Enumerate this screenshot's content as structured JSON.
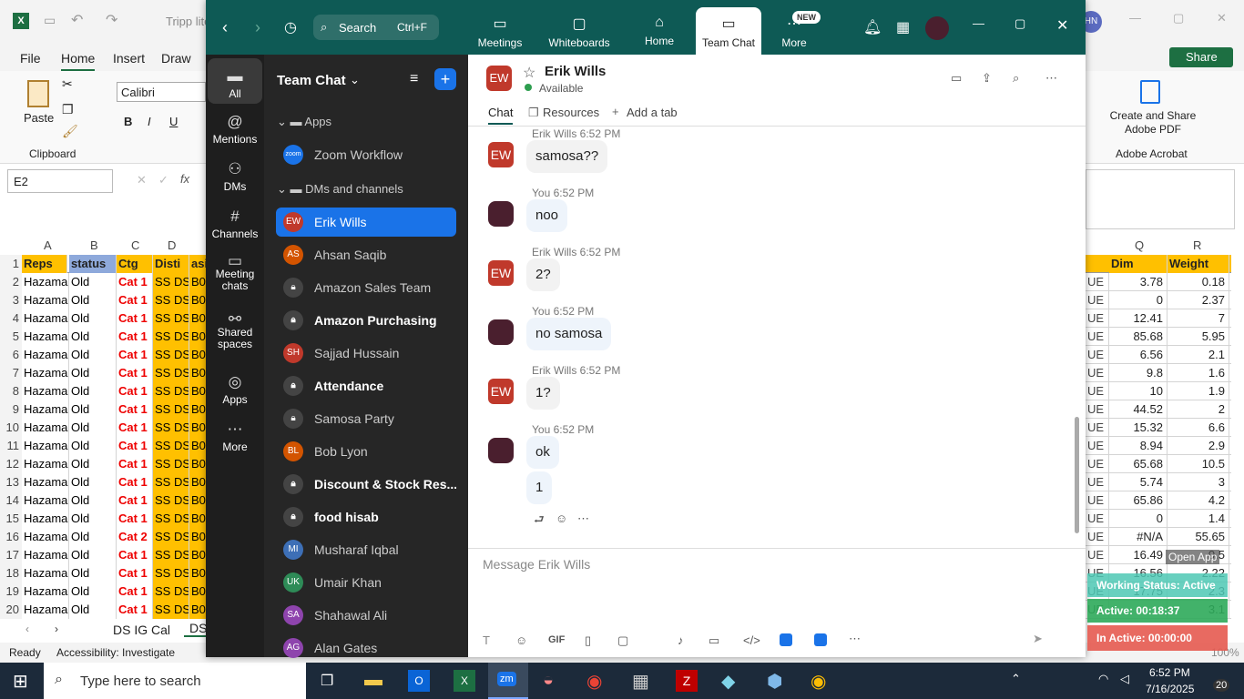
{
  "excel": {
    "title": "Tripp lite",
    "menu": [
      "File",
      "Home",
      "Insert",
      "Draw"
    ],
    "font": "Calibri",
    "namebox": "E2",
    "clipboard": "Clipboard",
    "paste": "Paste",
    "create_share": "Create and Share Adobe PDF",
    "adobe": "Adobe Acrobat",
    "share": "Share",
    "avatar": "HN",
    "col_headers": [
      "A",
      "B",
      "C",
      "D"
    ],
    "right_cols": [
      "Q",
      "R"
    ],
    "header_row": [
      "Reps",
      "status",
      "Ctg",
      "Disti",
      "asi"
    ],
    "right_header": [
      "Dim",
      "Weight"
    ],
    "rows": [
      {
        "n": "2",
        "a": "Hazama",
        "b": "Old",
        "c": "Cat 1",
        "d": "SS DS",
        "e": "B0",
        "q": "3.78",
        "r": "0.18"
      },
      {
        "n": "3",
        "a": "Hazama",
        "b": "Old",
        "c": "Cat 1",
        "d": "SS DS",
        "e": "B0",
        "q": "0",
        "r": "2.37"
      },
      {
        "n": "4",
        "a": "Hazama",
        "b": "Old",
        "c": "Cat 1",
        "d": "SS DS",
        "e": "B0",
        "q": "12.41",
        "r": "7"
      },
      {
        "n": "5",
        "a": "Hazama",
        "b": "Old",
        "c": "Cat 1",
        "d": "SS DS",
        "e": "B0",
        "q": "85.68",
        "r": "5.95"
      },
      {
        "n": "6",
        "a": "Hazama",
        "b": "Old",
        "c": "Cat 1",
        "d": "SS DS",
        "e": "B0",
        "q": "6.56",
        "r": "2.1"
      },
      {
        "n": "7",
        "a": "Hazama",
        "b": "Old",
        "c": "Cat 1",
        "d": "SS DS",
        "e": "B0",
        "q": "9.8",
        "r": "1.6"
      },
      {
        "n": "8",
        "a": "Hazama",
        "b": "Old",
        "c": "Cat 1",
        "d": "SS DS",
        "e": "B0",
        "q": "10",
        "r": "1.9"
      },
      {
        "n": "9",
        "a": "Hazama",
        "b": "Old",
        "c": "Cat 1",
        "d": "SS DS",
        "e": "B0",
        "q": "44.52",
        "r": "2"
      },
      {
        "n": "10",
        "a": "Hazama",
        "b": "Old",
        "c": "Cat 1",
        "d": "SS DS",
        "e": "B0",
        "q": "15.32",
        "r": "6.6"
      },
      {
        "n": "11",
        "a": "Hazama",
        "b": "Old",
        "c": "Cat 1",
        "d": "SS DS",
        "e": "B0",
        "q": "8.94",
        "r": "2.9"
      },
      {
        "n": "12",
        "a": "Hazama",
        "b": "Old",
        "c": "Cat 1",
        "d": "SS DS",
        "e": "B0",
        "q": "65.68",
        "r": "10.5"
      },
      {
        "n": "13",
        "a": "Hazama",
        "b": "Old",
        "c": "Cat 1",
        "d": "SS DS",
        "e": "B0",
        "q": "5.74",
        "r": "3"
      },
      {
        "n": "14",
        "a": "Hazama",
        "b": "Old",
        "c": "Cat 1",
        "d": "SS DS",
        "e": "B0",
        "q": "65.86",
        "r": "4.2"
      },
      {
        "n": "15",
        "a": "Hazama",
        "b": "Old",
        "c": "Cat 1",
        "d": "SS DS",
        "e": "B0",
        "q": "0",
        "r": "1.4"
      },
      {
        "n": "16",
        "a": "Hazama",
        "b": "Old",
        "c": "Cat 2",
        "d": "SS DS",
        "e": "B0",
        "q": "#N/A",
        "r": "55.65"
      },
      {
        "n": "17",
        "a": "Hazama",
        "b": "Old",
        "c": "Cat 1",
        "d": "SS DS",
        "e": "B0",
        "q": "16.49",
        "r": "0.5"
      },
      {
        "n": "18",
        "a": "Hazama",
        "b": "Old",
        "c": "Cat 1",
        "d": "SS DS",
        "e": "B0",
        "q": "16.56",
        "r": "2.22"
      },
      {
        "n": "19",
        "a": "Hazama",
        "b": "Old",
        "c": "Cat 1",
        "d": "SS DS",
        "e": "B0",
        "q": "17.75",
        "r": "2.3"
      },
      {
        "n": "20",
        "a": "Hazama",
        "b": "Old",
        "c": "Cat 1",
        "d": "SS DS",
        "e": "B0",
        "q": "",
        "r": "3.1"
      }
    ],
    "sheet_tab": "DS IG Cal",
    "sheet_tab2": "DS",
    "status_ready": "Ready",
    "accessibility": "Accessibility: Investigate",
    "zoom_pct": "100%"
  },
  "zoom": {
    "search": "Search",
    "search_shortcut": "Ctrl+F",
    "tabs": [
      "Meetings",
      "Whiteboards",
      "Home",
      "Team Chat",
      "More"
    ],
    "new_badge": "NEW",
    "rail": [
      "All",
      "Mentions",
      "DMs",
      "Channels",
      "Meeting chats",
      "Shared spaces",
      "Apps",
      "More"
    ],
    "list_title": "Team Chat",
    "apps_section": "Apps",
    "dm_section": "DMs and channels",
    "items": [
      {
        "label": "Zoom Workflow",
        "av": "zoom",
        "bold": false
      },
      {
        "label": "Erik Wills",
        "av": "EW",
        "bold": false
      },
      {
        "label": "Ahsan Saqib",
        "av": "AS",
        "bold": false
      },
      {
        "label": "Amazon Sales Team",
        "av": "",
        "bold": false
      },
      {
        "label": "Amazon Purchasing",
        "av": "",
        "bold": true
      },
      {
        "label": "Sajjad Hussain",
        "av": "SH",
        "bold": false
      },
      {
        "label": "Attendance",
        "av": "",
        "bold": true
      },
      {
        "label": "Samosa Party",
        "av": "",
        "bold": false
      },
      {
        "label": "Bob Lyon",
        "av": "BL",
        "bold": false
      },
      {
        "label": "Discount & Stock Res...",
        "av": "",
        "bold": true
      },
      {
        "label": "food hisab",
        "av": "",
        "bold": true
      },
      {
        "label": "Musharaf Iqbal",
        "av": "MI",
        "bold": false
      },
      {
        "label": "Umair Khan",
        "av": "UK",
        "bold": false
      },
      {
        "label": "Shahawal Ali",
        "av": "SA",
        "bold": false
      },
      {
        "label": "Alan Gates",
        "av": "AG",
        "bold": false
      }
    ],
    "contact_name": "Erik Wills",
    "contact_initials": "EW",
    "contact_status": "Available",
    "chat_tabs": [
      "Chat",
      "Resources",
      "Add a tab"
    ],
    "messages": [
      {
        "meta": "Erik Wills 6:52 PM",
        "text": "samosa??",
        "who": "ew"
      },
      {
        "meta": "You 6:52 PM",
        "text": "noo",
        "who": "you"
      },
      {
        "meta": "Erik Wills 6:52 PM",
        "text": "2?",
        "who": "ew"
      },
      {
        "meta": "You 6:52 PM",
        "text": "no samosa",
        "who": "you"
      },
      {
        "meta": "Erik Wills 6:52 PM",
        "text": "1?",
        "who": "ew"
      },
      {
        "meta": "You 6:52 PM",
        "text": "ok",
        "who": "you"
      }
    ],
    "last_msg": "1",
    "compose_placeholder": "Message Erik Wills"
  },
  "overlay": {
    "open_app": "Open App",
    "working": "Working Status: Active",
    "active": "Active: 00:18:37",
    "inactive": "In Active: 00:00:00"
  },
  "taskbar": {
    "search": "Type here to search",
    "time": "6:52 PM",
    "date": "7/16/2025",
    "notif": "20"
  }
}
